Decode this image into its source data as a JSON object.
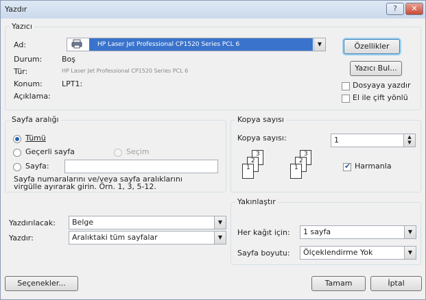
{
  "window": {
    "title": "Yazdır",
    "help_label": "?",
    "close_label": "✕"
  },
  "printer": {
    "group_title": "Yazıcı",
    "name_label": "Ad:",
    "name_value": "HP Laser Jet Professional CP1520 Series PCL 6",
    "status_label": "Durum:",
    "status_value": "Boş",
    "type_label": "Tür:",
    "type_value": "HP Laser Jet Professional CP1520 Series PCL 6",
    "location_label": "Konum:",
    "location_value": "LPT1:",
    "comment_label": "Açıklama:",
    "properties_button": "Özellikler",
    "find_printer_button": "Yazıcı Bul...",
    "print_to_file_label": "Dosyaya yazdır",
    "manual_duplex_label": "El ile çift yönlü"
  },
  "range": {
    "group_title": "Sayfa aralığı",
    "all_label": "Tümü",
    "current_label": "Geçerli sayfa",
    "selection_label": "Seçim",
    "pages_label": "Sayfa:",
    "hint": "Sayfa numaralarını ve/veya sayfa aralıklarını virgülle ayırarak girin. Örn. 1, 3, 5-12."
  },
  "copies": {
    "group_title": "Kopya sayısı",
    "count_label": "Kopya sayısı:",
    "count_value": "1",
    "collate_label": "Harmanla",
    "page_digits": [
      "1",
      "2",
      "3"
    ]
  },
  "print_what": {
    "label": "Yazdırılacak:",
    "value": "Belge"
  },
  "print": {
    "label": "Yazdır:",
    "value": "Aralıktaki tüm sayfalar"
  },
  "zoom": {
    "group_title": "Yakınlaştır",
    "per_sheet_label": "Her kağıt için:",
    "per_sheet_value": "1 sayfa",
    "scale_label": "Sayfa boyutu:",
    "scale_value": "Ölçeklendirme Yok"
  },
  "footer": {
    "options_button": "Seçenekler...",
    "ok_button": "Tamam",
    "cancel_button": "İptal"
  }
}
